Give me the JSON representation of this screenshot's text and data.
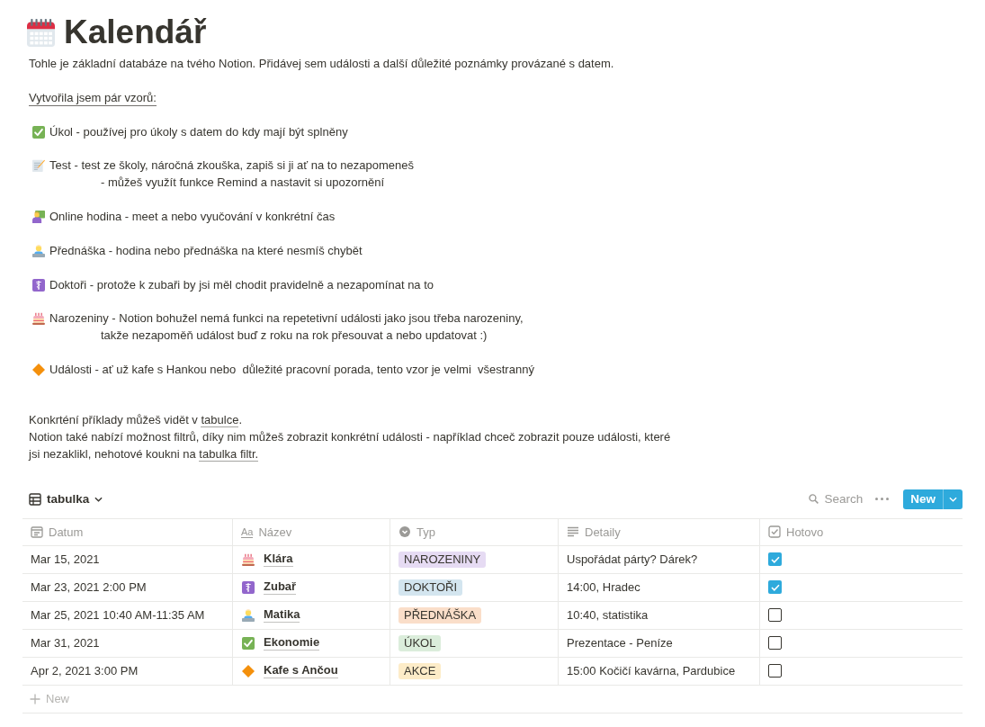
{
  "page": {
    "title": "Kalendář"
  },
  "intro": "Tohle je základní databáze na tvého Notion. Přidávej sem události a další důležité poznámky provázané s datem.",
  "templates_heading": "Vytvořila jsem pár vzorů:",
  "templates": [
    {
      "kind": "check",
      "lines": [
        "Úkol - používej pro úkoly s datem do kdy mají být splněny"
      ]
    },
    {
      "kind": "memo",
      "lines": [
        "Test - test ze školy, náročná zkouška, zapiš si ji ať na to nezapomeneš",
        "- můžeš využít funkce Remind a nastavit si upozornění"
      ]
    },
    {
      "kind": "teacher",
      "lines": [
        "Online hodina - meet a nebo vyučování v konkrétní čas"
      ]
    },
    {
      "kind": "laptop",
      "lines": [
        "Přednáška - hodina nebo přednáška na které nesmíš chybět"
      ]
    },
    {
      "kind": "medical",
      "lines": [
        "Doktoři - protože k zubaři by jsi měl chodit pravidelně a nezapomínat na to"
      ]
    },
    {
      "kind": "cake",
      "lines": [
        "Narozeniny - Notion bohužel nemá funkci na repetetivní události jako jsou třeba narozeniny,",
        "takže nezapoměň událost buď z roku na rok přesouvat a nebo updatovat :)"
      ]
    },
    {
      "kind": "diamond",
      "lines": [
        "Události - ať už kafe s Hankou nebo  důležité pracovní porada, tento vzor je velmi  všestranný"
      ]
    }
  ],
  "notes": [
    {
      "lines": [
        [
          {
            "text": "Konkrténí příklady můžeš vidět v ",
            "link": false
          },
          {
            "text": "tabulce",
            "link": true
          },
          {
            "text": ".",
            "link": false
          }
        ]
      ]
    },
    {
      "lines": [
        [
          {
            "text": "Notion také nabízí možnost filtrů, díky nim můžeš zobrazit konkrétní události - například chceč zobrazit pouze události, které",
            "link": false
          }
        ],
        [
          {
            "text": "jsi nezaklikl, nehotové koukni na ",
            "link": false
          },
          {
            "text": "tabulka filtr.",
            "link": true
          }
        ]
      ]
    }
  ],
  "toolbar": {
    "view": "tabulka",
    "search": "Search",
    "new_button": "New"
  },
  "table": {
    "columns": [
      {
        "kind": "date",
        "label": "Datum"
      },
      {
        "kind": "title",
        "label": "Název",
        "glyph": "Aa"
      },
      {
        "kind": "select",
        "label": "Typ"
      },
      {
        "kind": "text",
        "label": "Detaily"
      },
      {
        "kind": "checkbox",
        "label": "Hotovo"
      }
    ],
    "rows": [
      {
        "date": "Mar 15, 2021",
        "kind": "cake",
        "name": "Klára",
        "type": {
          "label": "NAROZENINY",
          "color": "#e6dbf3"
        },
        "detail": "Uspořádat párty? Dárek?",
        "done": true
      },
      {
        "date": "Mar 23, 2021 2:00 PM",
        "kind": "medical",
        "name": "Zubař",
        "type": {
          "label": "DOKTOŘI",
          "color": "#d3e5ef"
        },
        "detail": "14:00, Hradec",
        "done": true
      },
      {
        "date": "Mar 25, 2021 10:40 AM-11:35 AM",
        "kind": "laptop",
        "name": "Matika",
        "type": {
          "label": "PŘEDNÁŠKA",
          "color": "#fadec9"
        },
        "detail": "10:40, statistika",
        "done": false
      },
      {
        "date": "Mar 31, 2021",
        "kind": "check",
        "name": "Ekonomie",
        "type": {
          "label": "ÚKOL",
          "color": "#dbeddb"
        },
        "detail": "Prezentace - Peníze",
        "done": false
      },
      {
        "date": "Apr 2, 2021 3:00 PM",
        "kind": "diamond",
        "name": "Kafe s Ančou",
        "type": {
          "label": "AKCE",
          "color": "#fdecc8"
        },
        "detail": "15:00 Kočičí kavárna, Pardubice",
        "done": false
      }
    ],
    "add_row": "New"
  }
}
